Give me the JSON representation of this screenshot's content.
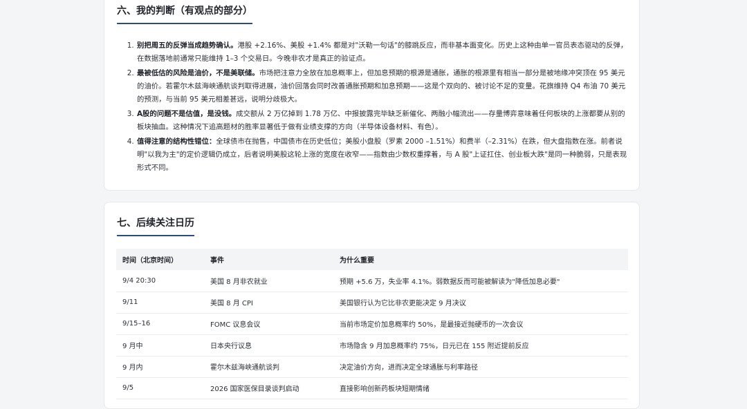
{
  "judgment_section": {
    "title": "六、我的判断（有观点的部分）",
    "items": [
      {
        "bold": "别把周五的反弹当成趋势确认。",
        "text": "港股 +2.16%、美股 +1.4% 都是对\"沃勒一句话\"的膝跳反应，而非基本面变化。历史上这种由单一官员表态驱动的反弹，在数据落地前通常只能维持 1–3 个交易日。今晚非农才是真正的验证点。"
      },
      {
        "bold": "最被低估的风险是油价，不是美联储。",
        "text": "市场把注意力全放在加息概率上，但加息预期的根源是通胀，通胀的根源里有相当一部分是被地缘冲突顶在 95 美元的油价。若霍尔木兹海峡通航谈判取得进展，油价回落会同时改善通胀预期和加息预期——这是个双向的、被讨论不足的变量。花旗维持 Q4 布油 70 美元的预测，与当前 95 美元相差甚远，说明分歧极大。"
      },
      {
        "bold": "A股的问题不是估值，是没钱。",
        "text": "成交额从 2 万亿掉到 1.78 万亿、中报披露完毕缺乏新催化、两融小幅流出——存量博弈意味着任何板块的上涨都要从别的板块抽血。这种情况下追高题材的胜率显著低于做有业绩支撑的方向（半导体设备材料、有色）。"
      },
      {
        "bold": "值得注意的结构性错位：",
        "text": "全球债市在抛售，中国债市在历史低位；美股小盘股（罗素 2000 –1.51%）和费半（–2.31%）在跌，但大盘指数在涨。前者说明\"以我为主\"的定价逻辑仍成立，后者说明美股这轮上涨的宽度在收窄——指数由少数权重撑着，与 A 股\"上证扛住、创业板大跌\"是同一种脆弱，只是表现形式不同。"
      }
    ]
  },
  "calendar_section": {
    "title": "七、后续关注日历",
    "headers": [
      "时间（北京时间）",
      "事件",
      "为什么重要"
    ],
    "rows": [
      [
        "9/4 20:30",
        "美国 8 月非农就业",
        "预期 +5.6 万，失业率 4.1%。弱数据反而可能被解读为\"降低加息必要\""
      ],
      [
        "9/11",
        "美国 8 月 CPI",
        "美国银行认为它比非农更能决定 9 月决议"
      ],
      [
        "9/15–16",
        "FOMC 议息会议",
        "当前市场定价加息概率约 50%，是最接近抛硬币的一次会议"
      ],
      [
        "9 月中",
        "日本央行议息",
        "市场隐含 9 月加息概率约 75%，日元已在 155 附近提前反应"
      ],
      [
        "9 月内",
        "霍尔木兹海峡通航谈判",
        "决定油价方向，进而决定全球通胀与利率路径"
      ],
      [
        "9/5",
        "2026 国家医保目录谈判启动",
        "直接影响创新药板块短期情绪"
      ]
    ]
  }
}
